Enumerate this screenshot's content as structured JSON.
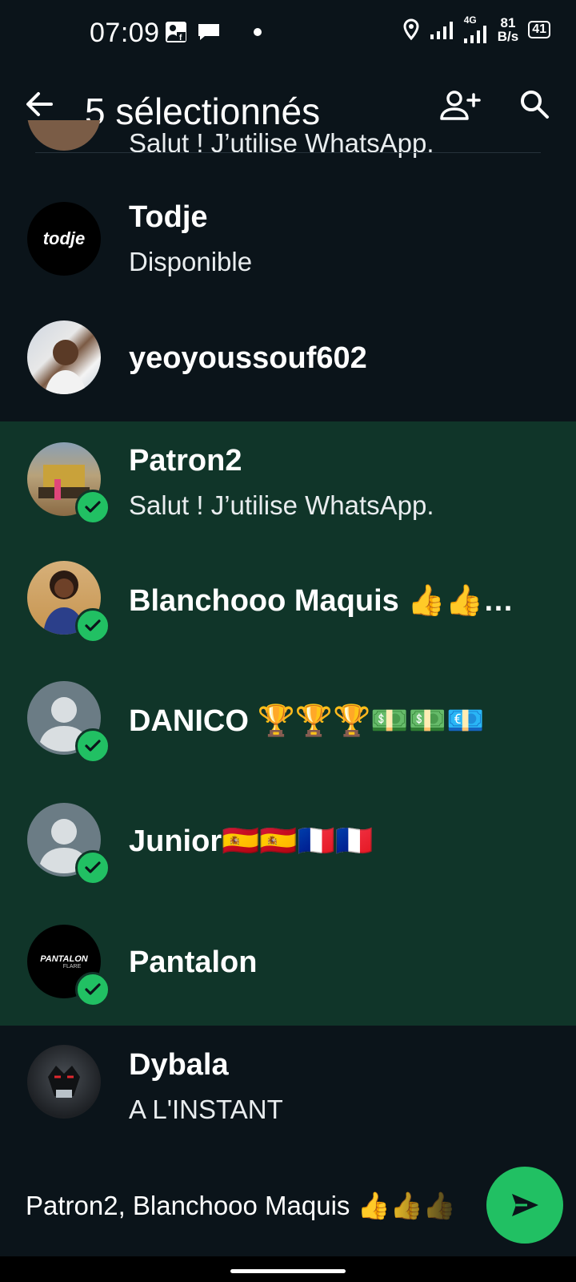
{
  "status_bar": {
    "time": "07:09",
    "network_type": "4G",
    "speed_value": "81",
    "speed_unit": "B/s",
    "battery": "41"
  },
  "appbar": {
    "title": "5 sélectionnés",
    "icons": [
      "back-arrow-icon",
      "add-contact-icon",
      "search-icon"
    ]
  },
  "partial_row": {
    "status": "Salut ! J’utilise WhatsApp."
  },
  "contacts": [
    {
      "name": "Todje",
      "status": "Disponible",
      "selected": false,
      "avatar": "todje-logo"
    },
    {
      "name": "yeoyoussouf602",
      "status": "",
      "selected": false,
      "avatar": "photo"
    },
    {
      "name": "Patron2",
      "status": "Salut ! J’utilise WhatsApp.",
      "selected": true,
      "avatar": "photo"
    },
    {
      "name": "Blanchooo Maquis 👍👍…",
      "status": "",
      "selected": true,
      "avatar": "photo"
    },
    {
      "name": "DANICO 🏆🏆🏆💵💵💶",
      "status": "",
      "selected": true,
      "avatar": "default"
    },
    {
      "name": "Junior🇪🇸🇪🇸🇫🇷🇫🇷",
      "status": "",
      "selected": true,
      "avatar": "default"
    },
    {
      "name": "Pantalon",
      "status": "",
      "selected": true,
      "avatar": "pantalon-logo"
    },
    {
      "name": "Dybala",
      "status": "A L'INSTANT",
      "selected": false,
      "avatar": "photo"
    }
  ],
  "avatar_text": {
    "todje": "todje",
    "pantalon": "PANTALON",
    "pantalon_sub": "FLARE"
  },
  "bottom": {
    "selected_names": "Patron2, Blanchooo Maquis 👍👍👍"
  },
  "colors": {
    "background": "#0b141a",
    "selected_row": "#103529",
    "accent": "#21c063"
  }
}
